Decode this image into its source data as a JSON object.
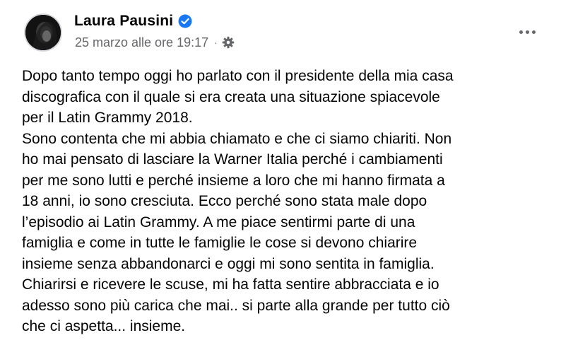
{
  "author": {
    "name": "Laura Pausini",
    "verified_icon": "verified-badge-icon",
    "avatar_icon": "profile-avatar"
  },
  "meta": {
    "timestamp": "25 marzo alle ore 19:17",
    "separator": "·",
    "privacy_icon": "gear-icon"
  },
  "more_icon": "more-options-icon",
  "post": {
    "lines": [
      "Dopo tanto tempo oggi ho parlato con il presidente della mia casa",
      "discografica con il quale si era creata una situazione spiacevole",
      "per il Latin Grammy 2018.",
      "Sono contenta che mi abbia chiamato e che ci siamo chiariti. Non",
      "ho mai pensato di lasciare la Warner Italia perché i cambiamenti",
      "per me sono lutti e perché insieme a loro che mi hanno firmata a",
      "18 anni, io sono cresciuta. Ecco perché sono stata male dopo",
      "l’episodio ai Latin Grammy. A me piace sentirmi parte di una",
      "famiglia e come in tutte le famiglie le cose si devono chiarire",
      "insieme senza abbandonarci e oggi mi sono sentita in famiglia.",
      "Chiarirsi e ricevere le scuse, mi ha fatta sentire abbracciata e io",
      "adesso sono più carica che mai.. si parte alla grande per tutto ciò",
      "che ci aspetta... insieme."
    ]
  },
  "colors": {
    "primary_text": "#050505",
    "secondary_text": "#65676b",
    "verified_blue": "#1877f2"
  }
}
